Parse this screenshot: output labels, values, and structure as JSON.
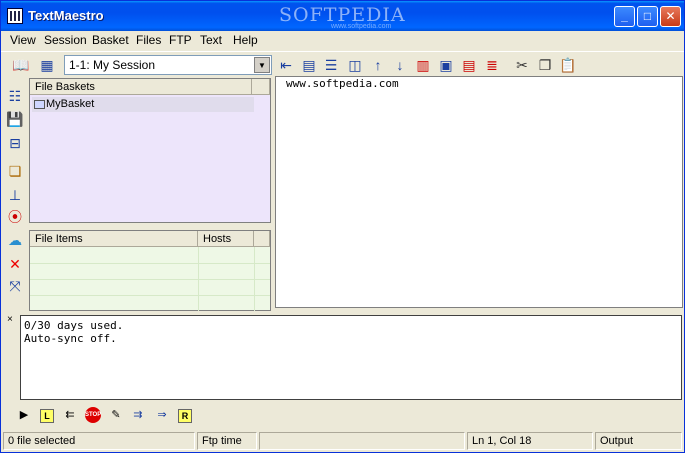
{
  "window": {
    "title": "TextMaestro",
    "watermark": "SOFTPEDIA",
    "watermark_sub": "www.softpedia.com",
    "min_label": "_",
    "max_label": "□",
    "close_label": "✕"
  },
  "menu": [
    "View",
    "Session",
    "Basket",
    "Files",
    "FTP",
    "Text",
    "Help"
  ],
  "toolbar": {
    "session_value": "1-1: My Session",
    "icons": [
      "book-icon",
      "calendar-icon",
      "indent-icon",
      "bookmark-icon",
      "list-icon",
      "columns-icon",
      "arrow-up-icon",
      "arrow-down-icon",
      "trash-icon",
      "copy-doc-icon",
      "red-doc-icon",
      "lines-icon",
      "cut-icon",
      "copy-icon",
      "paste-icon"
    ]
  },
  "left_toolbar": [
    "list-view-icon",
    "save-icon",
    "panel-icon",
    "sessions-icon",
    "upload-icon",
    "broadcast-icon",
    "network-icon",
    "delete-icon",
    "connect-icon"
  ],
  "baskets": {
    "header": "File Baskets",
    "items": [
      "MyBasket"
    ]
  },
  "file_items": {
    "columns": [
      "File Items",
      "Hosts"
    ]
  },
  "editor": {
    "lines": [
      "www.softpedia.com"
    ]
  },
  "output": {
    "close": "×",
    "lines": [
      "0/30 days used.",
      "Auto-sync off."
    ]
  },
  "bottom_toolbar": {
    "icons": [
      "play-icon",
      "left-box-icon",
      "left-arrow-icon",
      "stop-icon",
      "edit-icon",
      "sync-right-icon",
      "right-arrow-icon",
      "right-box-icon"
    ],
    "box_left": "L",
    "box_right": "R",
    "stop_label": "STOP"
  },
  "status": {
    "files": "0 file selected",
    "ftp": "Ftp time",
    "position": "Ln 1, Col 18",
    "mode": "Output"
  }
}
